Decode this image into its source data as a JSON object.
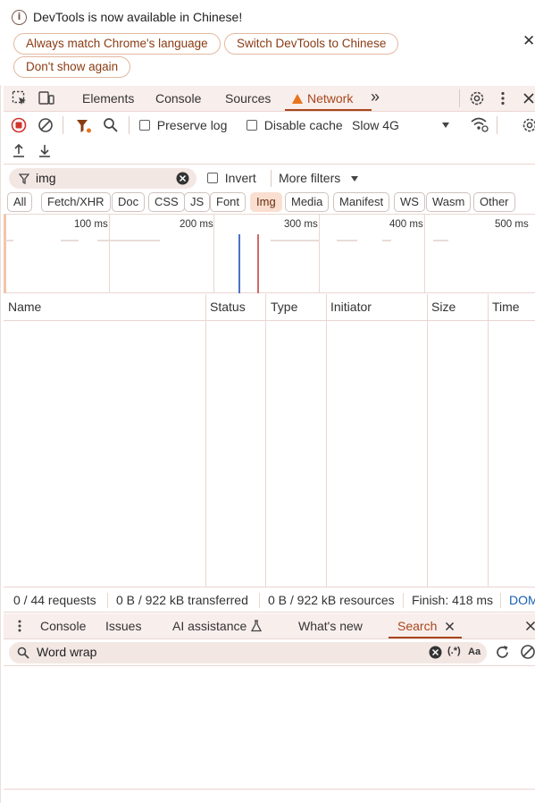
{
  "infobar": {
    "message": "DevTools is now available in Chinese!",
    "btn_match": "Always match Chrome's language",
    "btn_switch": "Switch DevTools to Chinese",
    "btn_dismiss": "Don't show again",
    "close": "✕"
  },
  "tabs": {
    "elements": "Elements",
    "console": "Console",
    "sources": "Sources",
    "network": "Network",
    "more": "»"
  },
  "network_toolbar": {
    "preserve_log": "Preserve log",
    "disable_cache": "Disable cache",
    "throttling": "Slow 4G"
  },
  "filter": {
    "value": "img",
    "invert": "Invert",
    "more_filters": "More filters"
  },
  "chips": [
    "All",
    "Fetch/XHR",
    "Doc",
    "CSS",
    "JS",
    "Font",
    "Img",
    "Media",
    "Manifest",
    "WS",
    "Wasm",
    "Other"
  ],
  "active_chip": "Img",
  "overview": {
    "ticks": [
      "100 ms",
      "200 ms",
      "300 ms",
      "400 ms",
      "500 ms"
    ],
    "blue_line": "#4a72c6",
    "red_line": "#d06a66"
  },
  "table": {
    "headers": [
      "Name",
      "Status",
      "Type",
      "Initiator",
      "Size",
      "Time"
    ]
  },
  "summary": {
    "requests": "0 / 44 requests",
    "transferred": "0 B / 922 kB transferred",
    "resources": "0 B / 922 kB resources",
    "finish": "Finish: 418 ms",
    "dom": "DOMC"
  },
  "drawer": {
    "console": "Console",
    "issues": "Issues",
    "ai": "AI assistance",
    "whats_new": "What's new",
    "search": "Search",
    "search_value": "Word wrap",
    "regex": "(.*)",
    "case": "Aa"
  },
  "colors": {
    "accent": "#a8461c",
    "tabbar_bg": "#f8eeec",
    "border": "#ead6d0"
  }
}
